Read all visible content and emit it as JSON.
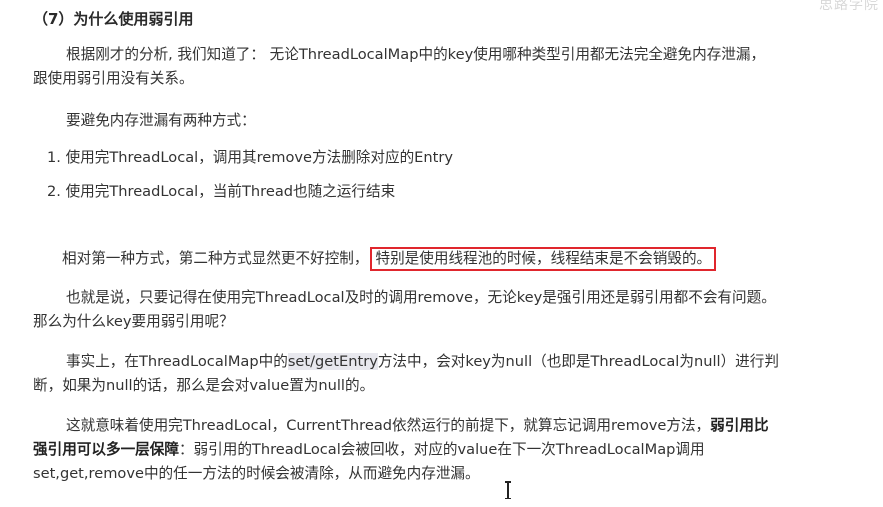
{
  "heading": "（7）为什么使用弱引用",
  "watermark": "思路学院",
  "para1_line1": "根据刚才的分析, 我们知道了： 无论ThreadLocalMap中的key使用哪种类型引用都无法完全避免内存泄漏，",
  "para1_line2": "跟使用弱引用没有关系。",
  "para2": "要避免内存泄漏有两种方式：",
  "list": [
    {
      "num": "1.",
      "text": "使用完ThreadLocal，调用其remove方法删除对应的Entry"
    },
    {
      "num": "2.",
      "text": "使用完ThreadLocal，当前Thread也随之运行结束"
    }
  ],
  "para3_pre": "相对第一种方式，第二种方式显然更不好控制，",
  "para3_boxed": "特别是使用线程池的时候，线程结束是不会销毁的。",
  "para4_line1": "也就是说，只要记得在使用完ThreadLocal及时的调用remove，无论key是强引用还是弱引用都不会有问题。",
  "para4_line2": "那么为什么key要用弱引用呢？",
  "para5_pre": "事实上，在ThreadLocalMap中的",
  "para5_code": "set/getEntry",
  "para5_post": "方法中，会对key为null（也即是ThreadLocal为null）进行判",
  "para5_line2": "断，如果为null的话，那么是会对value置为null的。",
  "para6_pre": "这就意味着使用完ThreadLocal，CurrentThread依然运行的前提下，就算忘记调用remove方法，",
  "para6_bold1": "弱引用比",
  "para6_bold2": "强引用可以多一层保障",
  "para6_line2_post": "：弱引用的ThreadLocal会被回收，对应的value在下一次ThreadLocalMap调用",
  "para6_line3": "set,get,remove中的任一方法的时候会被清除，从而避免内存泄漏。"
}
